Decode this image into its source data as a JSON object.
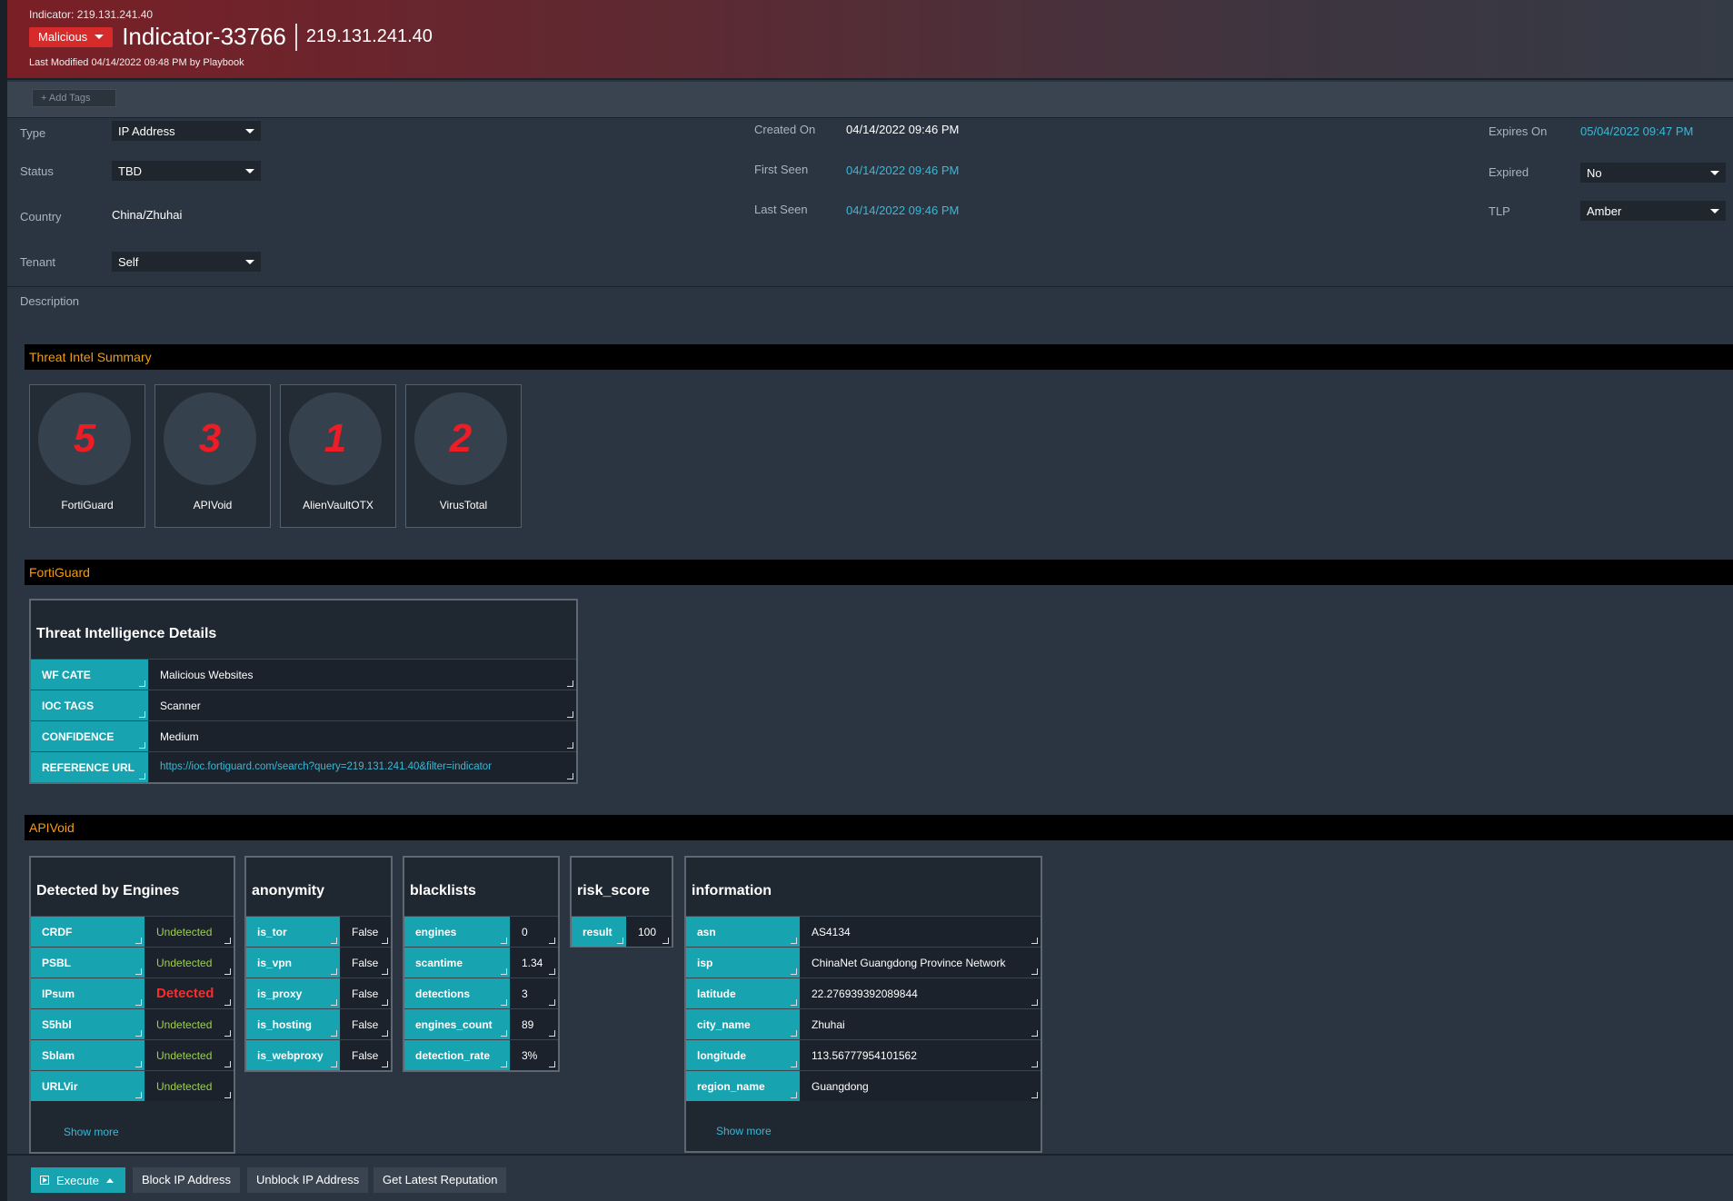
{
  "header": {
    "indicator_line": "Indicator: 219.131.241.40",
    "reputation": "Malicious",
    "title": "Indicator-33766",
    "ip": "219.131.241.40",
    "last_modified": "Last Modified 04/14/2022 09:48 PM by Playbook"
  },
  "tags": {
    "add_label": "+ Add Tags"
  },
  "fields": {
    "type_label": "Type",
    "type_value": "IP Address",
    "status_label": "Status",
    "status_value": "TBD",
    "country_label": "Country",
    "country_value": "China/Zhuhai",
    "tenant_label": "Tenant",
    "tenant_value": "Self",
    "created_label": "Created On",
    "created_value": "04/14/2022 09:46 PM",
    "first_seen_label": "First Seen",
    "first_seen_value": "04/14/2022 09:46 PM",
    "last_seen_label": "Last Seen",
    "last_seen_value": "04/14/2022 09:46 PM",
    "expires_label": "Expires On",
    "expires_value": "05/04/2022 09:47 PM",
    "expired_label": "Expired",
    "expired_value": "No",
    "tlp_label": "TLP",
    "tlp_value": "Amber",
    "description_label": "Description"
  },
  "summary": {
    "title": "Threat Intel Summary",
    "cards": [
      {
        "count": "5",
        "source": "FortiGuard"
      },
      {
        "count": "3",
        "source": "APIVoid"
      },
      {
        "count": "1",
        "source": "AlienVaultOTX"
      },
      {
        "count": "2",
        "source": "VirusTotal"
      }
    ]
  },
  "fortiguard": {
    "section": "FortiGuard",
    "table_title": "Threat Intelligence Details",
    "rows": [
      {
        "key": "WF CATE",
        "value": "Malicious Websites"
      },
      {
        "key": "IOC TAGS",
        "value": "Scanner"
      },
      {
        "key": "CONFIDENCE",
        "value": "Medium"
      },
      {
        "key": "REFERENCE URL",
        "value": "https://ioc.fortiguard.com/search?query=219.131.241.40&filter=indicator"
      }
    ]
  },
  "apivoid": {
    "section": "APIVoid",
    "engines": {
      "title": "Detected by Engines",
      "rows": [
        {
          "key": "CRDF",
          "value": "Undetected"
        },
        {
          "key": "PSBL",
          "value": "Undetected"
        },
        {
          "key": "IPsum",
          "value": "Detected"
        },
        {
          "key": "S5hbl",
          "value": "Undetected"
        },
        {
          "key": "Sblam",
          "value": "Undetected"
        },
        {
          "key": "URLVir",
          "value": "Undetected"
        }
      ],
      "show_more": "Show more"
    },
    "anonymity": {
      "title": "anonymity",
      "rows": [
        {
          "key": "is_tor",
          "value": "False"
        },
        {
          "key": "is_vpn",
          "value": "False"
        },
        {
          "key": "is_proxy",
          "value": "False"
        },
        {
          "key": "is_hosting",
          "value": "False"
        },
        {
          "key": "is_webproxy",
          "value": "False"
        }
      ]
    },
    "blacklists": {
      "title": "blacklists",
      "rows": [
        {
          "key": "engines",
          "value": "0"
        },
        {
          "key": "scantime",
          "value": "1.34"
        },
        {
          "key": "detections",
          "value": "3"
        },
        {
          "key": "engines_count",
          "value": "89"
        },
        {
          "key": "detection_rate",
          "value": "3%"
        }
      ]
    },
    "risk": {
      "title": "risk_score",
      "rows": [
        {
          "key": "result",
          "value": "100"
        }
      ]
    },
    "information": {
      "title": "information",
      "rows": [
        {
          "key": "asn",
          "value": "AS4134"
        },
        {
          "key": "isp",
          "value": "ChinaNet Guangdong Province Network"
        },
        {
          "key": "latitude",
          "value": "22.276939392089844"
        },
        {
          "key": "city_name",
          "value": "Zhuhai"
        },
        {
          "key": "longitude",
          "value": "113.56777954101562"
        },
        {
          "key": "region_name",
          "value": "Guangdong"
        }
      ],
      "show_more": "Show more"
    }
  },
  "actions": {
    "execute": "Execute",
    "block": "Block IP Address",
    "unblock": "Unblock IP Address",
    "reputation": "Get Latest Reputation"
  },
  "colors": {
    "malicious": "#d72b2b",
    "accent": "#17a3b0",
    "section_title": "#f39c12",
    "link": "#3ab8d6",
    "detected": "#ff2a2a",
    "undetected": "#9cd14a"
  }
}
